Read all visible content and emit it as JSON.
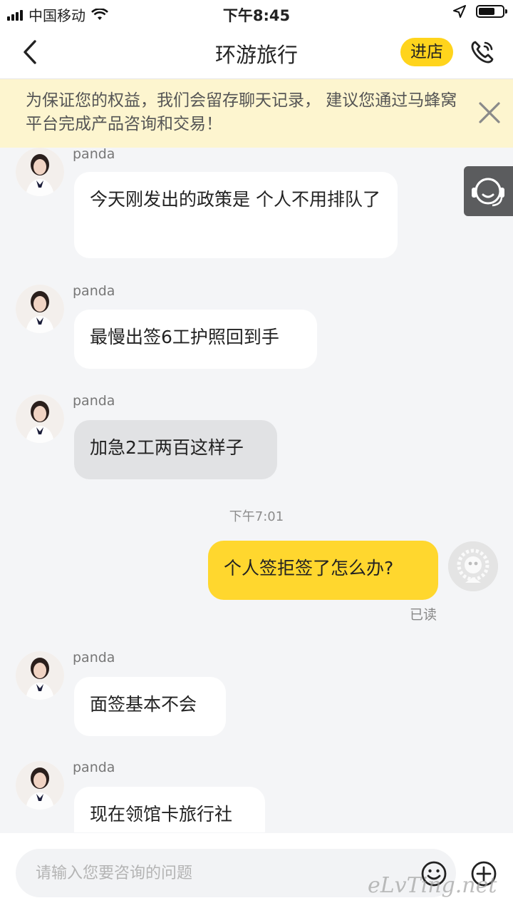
{
  "status_bar": {
    "carrier": "中国移动",
    "time": "下午8:45"
  },
  "header": {
    "title": "环游旅行",
    "shop_label": "进店"
  },
  "notice": {
    "text": "为保证您的权益，我们会留存聊天记录， 建议您通过马蜂窝平台完成产品咨询和交易！"
  },
  "messages": [
    {
      "sender": "panda",
      "text": "今天刚发出的政策是  个人不用排队了"
    },
    {
      "sender": "panda",
      "text": "最慢出签6工护照回到手"
    },
    {
      "sender": "panda",
      "text": "加急2工两百这样子"
    },
    {
      "time_separator": "下午7:01"
    },
    {
      "self_text": "个人签拒签了怎么办?",
      "read_status": "已读"
    },
    {
      "sender": "panda",
      "text": "面签基本不会"
    },
    {
      "sender": "panda",
      "text": "现在领馆卡旅行社"
    }
  ],
  "input": {
    "placeholder": "请输入您要咨询的问题"
  },
  "watermark": "eLvTing.net",
  "colors": {
    "accent": "#ffd41c",
    "notice_bg": "#fdf5cf",
    "self_bubble": "#ffd72e"
  }
}
